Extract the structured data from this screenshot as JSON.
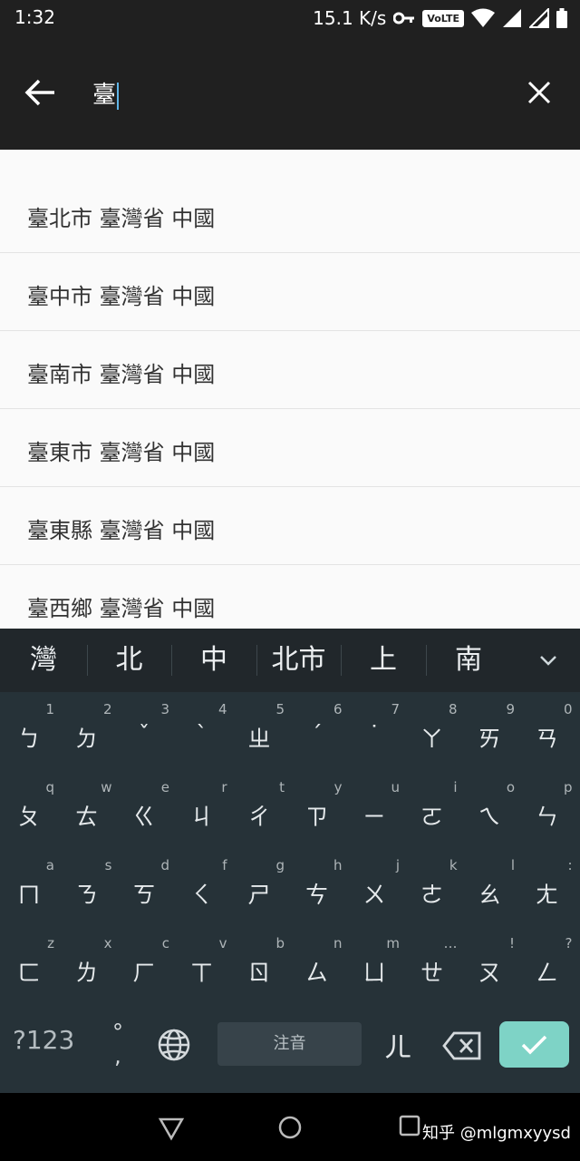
{
  "status_bar": {
    "time": "1:32",
    "network_speed": "15.1 K/s",
    "volte": "VoLTE"
  },
  "search": {
    "query": "臺",
    "back_icon": "arrow-left-icon",
    "clear_icon": "close-icon"
  },
  "results": [
    "臺北市 臺灣省 中國",
    "臺中市 臺灣省 中國",
    "臺南市 臺灣省 中國",
    "臺東市 臺灣省 中國",
    "臺東縣 臺灣省 中國",
    "臺西鄉 臺灣省 中國"
  ],
  "keyboard": {
    "suggestions": [
      "灣",
      "北",
      "中",
      "北市",
      "上",
      "南"
    ],
    "rows": [
      [
        {
          "hint": "1",
          "char": "ㄅ"
        },
        {
          "hint": "2",
          "char": "ㄉ"
        },
        {
          "hint": "3",
          "char": "ˇ"
        },
        {
          "hint": "4",
          "char": "ˋ"
        },
        {
          "hint": "5",
          "char": "ㄓ"
        },
        {
          "hint": "6",
          "char": "ˊ"
        },
        {
          "hint": "7",
          "char": "˙"
        },
        {
          "hint": "8",
          "char": "ㄚ"
        },
        {
          "hint": "9",
          "char": "ㄞ"
        },
        {
          "hint": "0",
          "char": "ㄢ"
        }
      ],
      [
        {
          "hint": "q",
          "char": "ㄆ"
        },
        {
          "hint": "w",
          "char": "ㄊ"
        },
        {
          "hint": "e",
          "char": "ㄍ"
        },
        {
          "hint": "r",
          "char": "ㄐ"
        },
        {
          "hint": "t",
          "char": "ㄔ"
        },
        {
          "hint": "y",
          "char": "ㄗ"
        },
        {
          "hint": "u",
          "char": "ㄧ"
        },
        {
          "hint": "i",
          "char": "ㄛ"
        },
        {
          "hint": "o",
          "char": "ㄟ"
        },
        {
          "hint": "p",
          "char": "ㄣ"
        }
      ],
      [
        {
          "hint": "a",
          "char": "ㄇ"
        },
        {
          "hint": "s",
          "char": "ㄋ"
        },
        {
          "hint": "d",
          "char": "ㄎ"
        },
        {
          "hint": "f",
          "char": "ㄑ"
        },
        {
          "hint": "g",
          "char": "ㄕ"
        },
        {
          "hint": "h",
          "char": "ㄘ"
        },
        {
          "hint": "j",
          "char": "ㄨ"
        },
        {
          "hint": "k",
          "char": "ㄜ"
        },
        {
          "hint": "l",
          "char": "ㄠ"
        },
        {
          "hint": ":",
          "char": "ㄤ"
        }
      ],
      [
        {
          "hint": "z",
          "char": "ㄈ"
        },
        {
          "hint": "x",
          "char": "ㄌ"
        },
        {
          "hint": "c",
          "char": "ㄏ"
        },
        {
          "hint": "v",
          "char": "ㄒ"
        },
        {
          "hint": "b",
          "char": "ㄖ"
        },
        {
          "hint": "n",
          "char": "ㄙ"
        },
        {
          "hint": "m",
          "char": "ㄩ"
        },
        {
          "hint": "…",
          "char": "ㄝ"
        },
        {
          "hint": "!",
          "char": "ㄡ"
        },
        {
          "hint": "?",
          "char": "ㄥ"
        }
      ]
    ],
    "symbols_label": "?123",
    "punct_top": "°",
    "punct_bottom": ",",
    "space_label": "注音",
    "er_key": "ㄦ",
    "accent_color": "#7ed3c6"
  },
  "nav_bar": {
    "watermark": "知乎 @mlgmxyysd"
  }
}
